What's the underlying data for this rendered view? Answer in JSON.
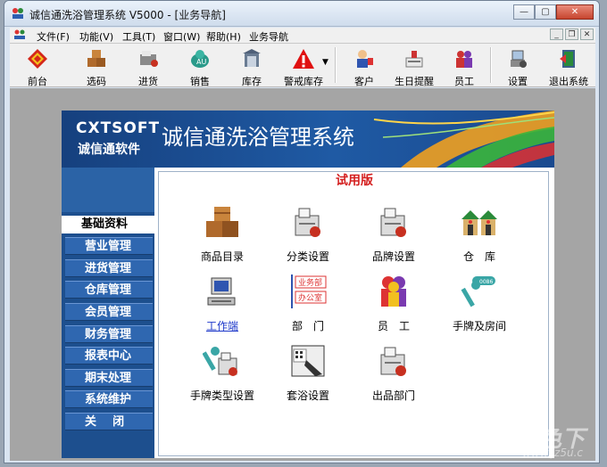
{
  "window": {
    "title": "诚信通洗浴管理系统 V5000 - [业务导航]"
  },
  "menu": [
    "文件(F)",
    "功能(V)",
    "工具(T)",
    "窗口(W)",
    "帮助(H)",
    "业务导航"
  ],
  "toolbar": [
    {
      "label": "前台",
      "icon": "front-desk-icon"
    },
    {
      "label": "选码",
      "icon": "boxes-icon"
    },
    {
      "label": "进货",
      "icon": "purchase-icon"
    },
    {
      "label": "销售",
      "icon": "sales-icon"
    },
    {
      "label": "库存",
      "icon": "inventory-icon"
    },
    {
      "label": "警戒库存",
      "icon": "warning-icon"
    },
    {
      "label": "客户",
      "icon": "customer-icon"
    },
    {
      "label": "生日提醒",
      "icon": "birthday-icon"
    },
    {
      "label": "员工",
      "icon": "staff-icon"
    },
    {
      "label": "设置",
      "icon": "settings-icon"
    },
    {
      "label": "退出系统",
      "icon": "exit-icon"
    }
  ],
  "banner": {
    "brand": "CXTSOFT",
    "brand_sub": "诚信通软件",
    "title": "诚信通洗浴管理系统"
  },
  "nav": [
    {
      "label": "基础资料",
      "active": true
    },
    {
      "label": "营业管理"
    },
    {
      "label": "进货管理"
    },
    {
      "label": "仓库管理"
    },
    {
      "label": "会员管理"
    },
    {
      "label": "财务管理"
    },
    {
      "label": "报表中心"
    },
    {
      "label": "期末处理"
    },
    {
      "label": "系统维护"
    },
    {
      "label": "关    闭"
    }
  ],
  "trial_label": "试用版",
  "items": [
    {
      "label": "商品目录",
      "icon": "product-catalog-icon"
    },
    {
      "label": "分类设置",
      "icon": "category-settings-icon"
    },
    {
      "label": "品牌设置",
      "icon": "brand-settings-icon"
    },
    {
      "label": "仓　库",
      "icon": "warehouse-icon"
    },
    {
      "label": "工作端",
      "icon": "workstation-icon"
    },
    {
      "label": "部　门",
      "icon": "department-icon",
      "dept_tags": [
        "业务部",
        "办公室"
      ]
    },
    {
      "label": "员　工",
      "icon": "employee-icon"
    },
    {
      "label": "手牌及房间",
      "icon": "key-tag-icon"
    },
    {
      "label": "手牌类型设置",
      "icon": "key-tag-type-icon"
    },
    {
      "label": "套浴设置",
      "icon": "bath-package-icon"
    },
    {
      "label": "出品部门",
      "icon": "output-department-icon"
    }
  ],
  "watermark": {
    "main": "JZ5U绿色下",
    "sub": "www.jz5u.c"
  }
}
